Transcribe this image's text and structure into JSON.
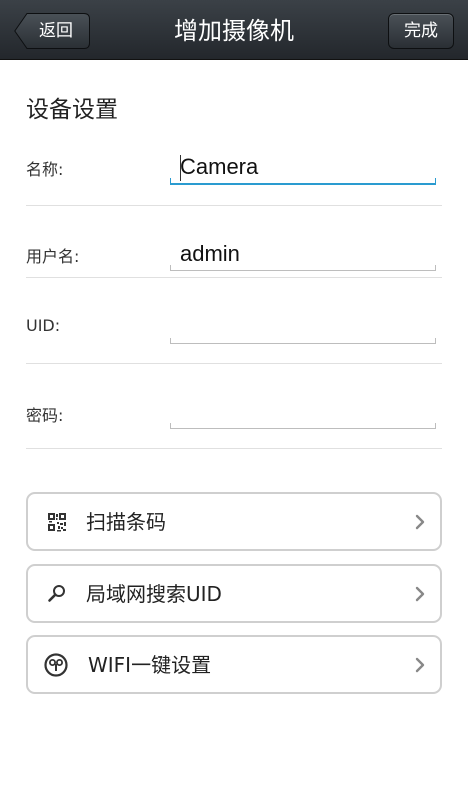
{
  "navbar": {
    "title": "增加摄像机",
    "back_label": "返回",
    "done_label": "完成"
  },
  "form": {
    "section_title": "设备设置",
    "name": {
      "label": "名称:",
      "value": "Camera"
    },
    "username": {
      "label": "用户名:",
      "value": "admin"
    },
    "uid": {
      "label": "UID:",
      "value": ""
    },
    "password": {
      "label": "密码:",
      "value": ""
    }
  },
  "actions": [
    {
      "label": "扫描条码",
      "icon": "qr-code-icon"
    },
    {
      "label": "局域网搜索UID",
      "icon": "search-icon"
    },
    {
      "label": "WIFI一键设置",
      "icon": "wifi-setup-icon"
    }
  ],
  "colors": {
    "navbar": "#2b3035",
    "active_field": "#2a9bd0",
    "divider": "#e0e0e0"
  }
}
